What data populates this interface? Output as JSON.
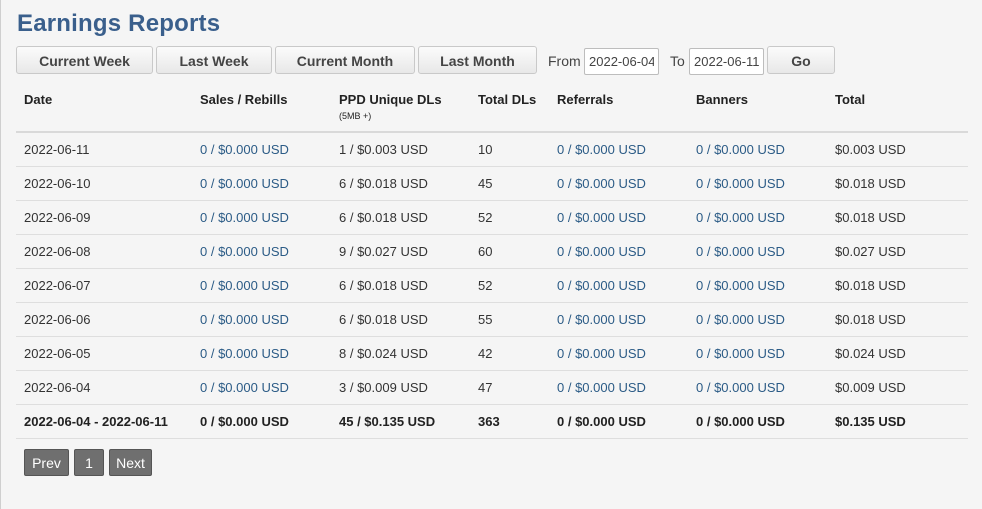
{
  "page": {
    "title": "Earnings Reports"
  },
  "toolbar": {
    "current_week": "Current Week",
    "last_week": "Last Week",
    "current_month": "Current Month",
    "last_month": "Last Month",
    "from_label": "From",
    "from_value": "2022-06-04",
    "to_label": "To",
    "to_value": "2022-06-11",
    "go": "Go"
  },
  "table": {
    "headers": [
      "Date",
      "Sales / Rebills",
      "PPD Unique DLs",
      "Total DLs",
      "Referrals",
      "Banners",
      "Total"
    ],
    "ppd_subheader": "(5MB +)",
    "rows": [
      [
        "2022-06-11",
        "0 / $0.000 USD",
        "1 / $0.003 USD",
        "10",
        "0 / $0.000 USD",
        "0 / $0.000 USD",
        "$0.003 USD"
      ],
      [
        "2022-06-10",
        "0 / $0.000 USD",
        "6 / $0.018 USD",
        "45",
        "0 / $0.000 USD",
        "0 / $0.000 USD",
        "$0.018 USD"
      ],
      [
        "2022-06-09",
        "0 / $0.000 USD",
        "6 / $0.018 USD",
        "52",
        "0 / $0.000 USD",
        "0 / $0.000 USD",
        "$0.018 USD"
      ],
      [
        "2022-06-08",
        "0 / $0.000 USD",
        "9 / $0.027 USD",
        "60",
        "0 / $0.000 USD",
        "0 / $0.000 USD",
        "$0.027 USD"
      ],
      [
        "2022-06-07",
        "0 / $0.000 USD",
        "6 / $0.018 USD",
        "52",
        "0 / $0.000 USD",
        "0 / $0.000 USD",
        "$0.018 USD"
      ],
      [
        "2022-06-06",
        "0 / $0.000 USD",
        "6 / $0.018 USD",
        "55",
        "0 / $0.000 USD",
        "0 / $0.000 USD",
        "$0.018 USD"
      ],
      [
        "2022-06-05",
        "0 / $0.000 USD",
        "8 / $0.024 USD",
        "42",
        "0 / $0.000 USD",
        "0 / $0.000 USD",
        "$0.024 USD"
      ],
      [
        "2022-06-04",
        "0 / $0.000 USD",
        "3 / $0.009 USD",
        "47",
        "0 / $0.000 USD",
        "0 / $0.000 USD",
        "$0.009 USD"
      ]
    ],
    "total_row": [
      "2022-06-04 - 2022-06-11",
      "0 / $0.000 USD",
      "45 / $0.135 USD",
      "363",
      "0 / $0.000 USD",
      "0 / $0.000 USD",
      "$0.135 USD"
    ]
  },
  "pagination": {
    "prev": "Prev",
    "page": "1",
    "next": "Next"
  },
  "colors": {
    "title": "#3a5f8c",
    "link": "#2b5b86",
    "pager_bg": "#6f6f6f"
  }
}
